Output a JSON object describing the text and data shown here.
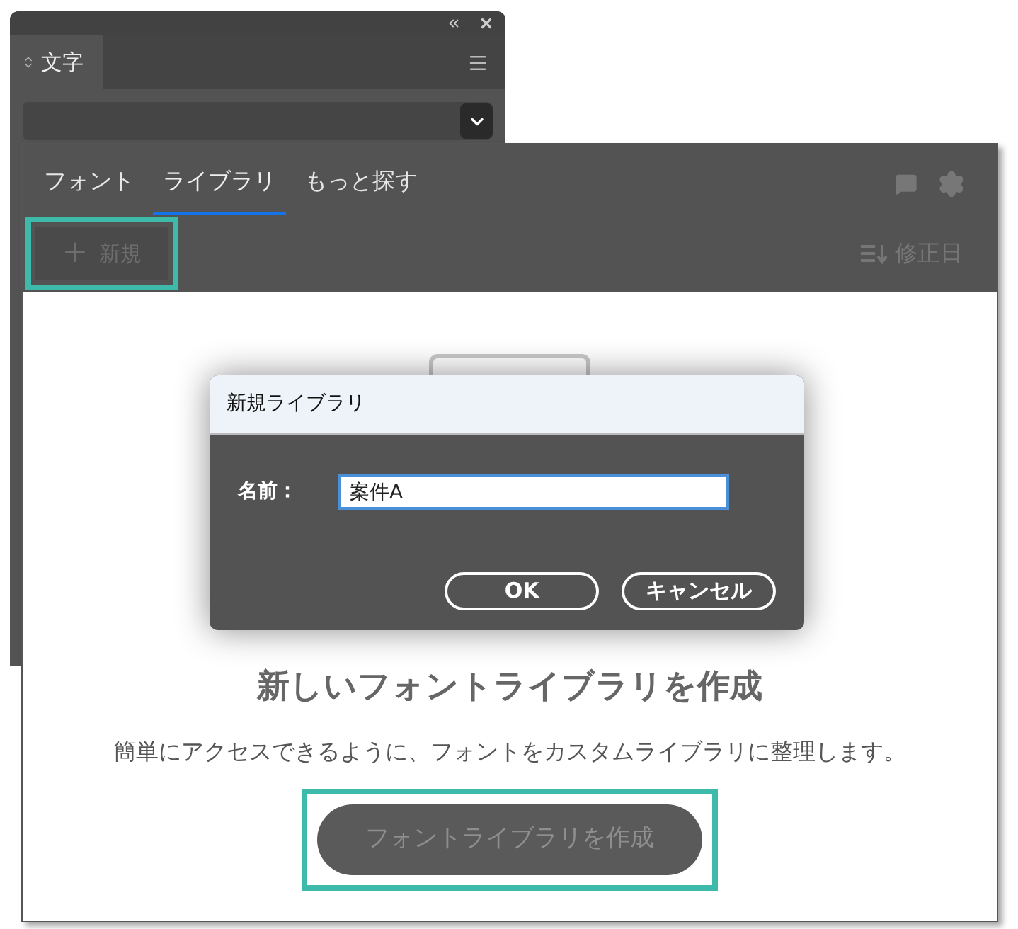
{
  "character_panel": {
    "title": "文字"
  },
  "library_panel": {
    "tabs": [
      {
        "label": "フォント",
        "selected": false
      },
      {
        "label": "ライブラリ",
        "selected": true
      },
      {
        "label": "もっと探す",
        "selected": false
      }
    ],
    "new_button": {
      "icon": "+",
      "label": "新規",
      "disabled": true,
      "highlighted": true
    },
    "sort": {
      "label": "修正日"
    },
    "empty_state": {
      "heading": "新しいフォントライブラリを作成",
      "description": "簡単にアクセスできるように、フォントをカスタムライブラリに整理します。",
      "create_button": {
        "label": "フォントライブラリを作成",
        "disabled": true,
        "highlighted": true
      }
    }
  },
  "dialog": {
    "title": "新規ライブラリ",
    "name_label": "名前：",
    "name_value": "案件A",
    "buttons": [
      {
        "label": "OK"
      },
      {
        "label": "キャンセル"
      }
    ]
  }
}
